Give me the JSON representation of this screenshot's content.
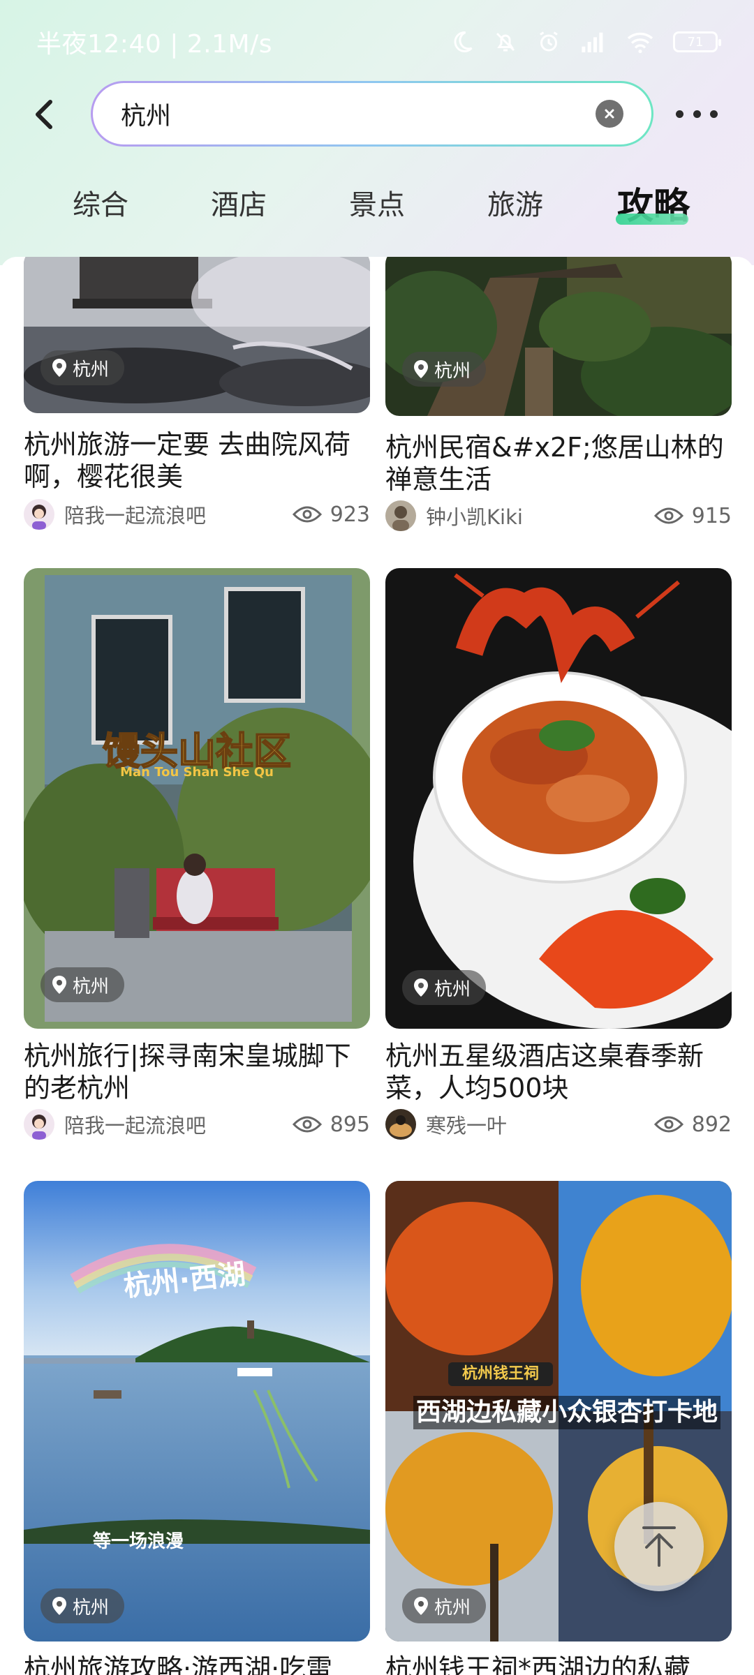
{
  "status_bar": {
    "time": "半夜12:40 | 2.1M/s",
    "battery": "71"
  },
  "search": {
    "value": "杭州"
  },
  "tabs": [
    {
      "label": "综合"
    },
    {
      "label": "酒店"
    },
    {
      "label": "景点"
    },
    {
      "label": "旅游"
    },
    {
      "label": "攻略",
      "active": true
    }
  ],
  "cards": [
    {
      "location": "杭州",
      "title": "杭州旅游一定要 去曲院风荷啊，樱花很美",
      "author": "陪我一起流浪吧",
      "views": "923"
    },
    {
      "location": "杭州",
      "title": "杭州民宿&#x2F;悠居山林的禅意生活",
      "author": "钟小凯Kiki",
      "views": "915"
    },
    {
      "location": "杭州",
      "title": "杭州旅行|探寻南宋皇城脚下的老杭州",
      "author": "陪我一起流浪吧",
      "views": "895",
      "overlay_title": "馒头山社区",
      "overlay_subtitle": "Man Tou Shan She Qu"
    },
    {
      "location": "杭州",
      "title": "杭州五星级酒店这桌春季新菜，人均500块",
      "author": "寒残一叶",
      "views": "892"
    },
    {
      "location": "杭州",
      "title": "杭州旅游攻略·游西湖·吃雷",
      "overlay_title": "杭州·西湖",
      "overlay_subtitle": "等一场浪漫"
    },
    {
      "location": "杭州",
      "title": "杭州钱王祠*西湖边的私藏",
      "overlay_tag": "杭州钱王祠",
      "overlay_title": "西湖边私藏小众银杏打卡地"
    }
  ],
  "colors": {
    "accent": "#2fd38f",
    "text_primary": "#1a1a1a",
    "text_secondary": "#666666"
  },
  "icons": {
    "back": "chevron-left-icon",
    "clear": "clear-circle-icon",
    "more": "more-dots-icon",
    "location": "location-pin-icon",
    "views": "eye-icon",
    "back_to_top": "arrow-up-icon"
  }
}
